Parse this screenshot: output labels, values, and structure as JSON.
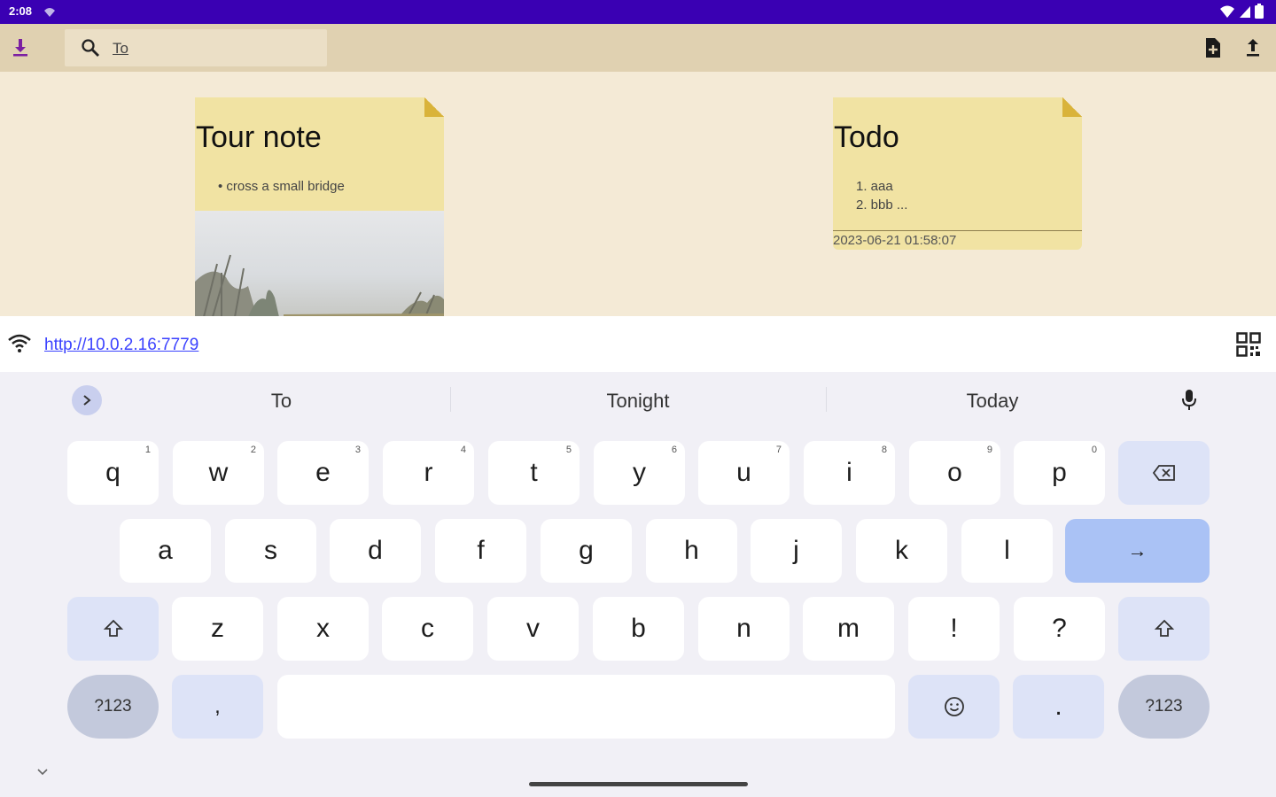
{
  "status": {
    "time": "2:08",
    "icons": [
      "notification-icon",
      "wifi-icon",
      "signal-icon",
      "battery-icon"
    ]
  },
  "toolbar": {
    "search_value": "To",
    "icons": [
      "download-icon",
      "search-icon",
      "new-file-icon",
      "upload-icon"
    ],
    "accent_color": "#7b1fa2"
  },
  "notes": [
    {
      "title": "Tour note",
      "body": [
        "• cross a small bridge"
      ],
      "has_image": true
    },
    {
      "title": "Todo",
      "body": [
        "1. aaa",
        "2. bbb ..."
      ],
      "date": "2023-06-21 01:58:07"
    }
  ],
  "server": {
    "url": "http://10.0.2.16:7779"
  },
  "keyboard": {
    "suggestions": [
      "To",
      "Tonight",
      "Today"
    ],
    "row1": [
      {
        "k": "q",
        "n": "1"
      },
      {
        "k": "w",
        "n": "2"
      },
      {
        "k": "e",
        "n": "3"
      },
      {
        "k": "r",
        "n": "4"
      },
      {
        "k": "t",
        "n": "5"
      },
      {
        "k": "y",
        "n": "6"
      },
      {
        "k": "u",
        "n": "7"
      },
      {
        "k": "i",
        "n": "8"
      },
      {
        "k": "o",
        "n": "9"
      },
      {
        "k": "p",
        "n": "0"
      }
    ],
    "row2": [
      "a",
      "s",
      "d",
      "f",
      "g",
      "h",
      "j",
      "k",
      "l"
    ],
    "row3": [
      "z",
      "x",
      "c",
      "v",
      "b",
      "n",
      "m",
      "!",
      "?"
    ],
    "symbols_label": "?123",
    "comma_label": ",",
    "period_label": ".",
    "enter_label": "→",
    "colors": {
      "key": "#ffffff",
      "func_key": "#dde3f7",
      "enter_key": "#aac2f5",
      "background": "#f1f0f6"
    }
  },
  "theme": {
    "status_bar": "#3a00b3",
    "app_bar": "#e0d1b1",
    "background": "#f4ead6",
    "note": "#f1e3a3",
    "link": "#3b42ff"
  }
}
